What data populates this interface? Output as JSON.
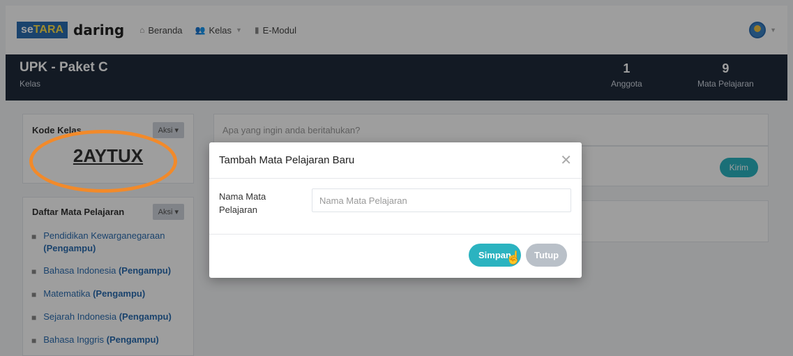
{
  "nav": {
    "logo_prefix": "se",
    "logo_highlight": "TARA",
    "logo_suffix": "daring",
    "items": [
      {
        "label": "Beranda",
        "icon": "home-icon"
      },
      {
        "label": "Kelas",
        "icon": "users-icon"
      },
      {
        "label": "E-Modul",
        "icon": "book-icon"
      }
    ]
  },
  "class": {
    "title": "UPK - Paket C",
    "subtitle": "Kelas",
    "members_count": "1",
    "members_label": "Anggota",
    "subjects_count": "9",
    "subjects_label": "Mata Pelajaran"
  },
  "code_panel": {
    "title": "Kode Kelas",
    "aksi": "Aksi ▾",
    "code": "2AYTUX"
  },
  "subjects_panel": {
    "title": "Daftar Mata Pelajaran",
    "aksi": "Aksi ▾",
    "items": [
      {
        "name": "Pendidikan Kewarganegaraan",
        "role": "(Pengampu)"
      },
      {
        "name": "Bahasa Indonesia",
        "role": "(Pengampu)"
      },
      {
        "name": "Matematika",
        "role": "(Pengampu)"
      },
      {
        "name": "Sejarah Indonesia",
        "role": "(Pengampu)"
      },
      {
        "name": "Bahasa Inggris",
        "role": "(Pengampu)"
      }
    ]
  },
  "post": {
    "placeholder": "Apa yang ingin anda beritahukan?",
    "send_label": "Kirim"
  },
  "modal": {
    "title": "Tambah Mata Pelajaran Baru",
    "field_label": "Nama Mata Pelajaran",
    "field_placeholder": "Nama Mata Pelajaran",
    "save_label": "Simpan",
    "close_label": "Tutup"
  },
  "colors": {
    "accent": "#2bb3c0",
    "header_bg": "#1f2a3a",
    "highlight": "#f28a2a"
  }
}
